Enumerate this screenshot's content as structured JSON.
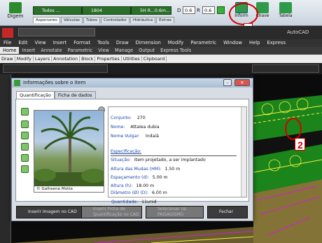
{
  "ribbon": {
    "digem_label": "Digem",
    "combo1_value": "Todos ...",
    "combo2_value": "1804",
    "combo3_value": "5H R...0.6m...",
    "d_label": "D",
    "d_value": "0.6",
    "r_label": "R",
    "r_value": "0.6",
    "tabs": [
      "Aspersores",
      "Válvulas",
      "Tubos",
      "Controlador",
      "Hidráulica",
      "Extras"
    ],
    "info_label": "Inform",
    "chave_label": "Chave",
    "tabela_label": "Tabela"
  },
  "acad": {
    "title": "AutoCAD",
    "menu": [
      "File",
      "Edit",
      "View",
      "Insert",
      "Format",
      "Tools",
      "Draw",
      "Dimension",
      "Modify",
      "Parametric",
      "Window",
      "Help",
      "Express"
    ],
    "tabs": [
      "Home",
      "Insert",
      "Annotate",
      "Parametric",
      "View",
      "Manage",
      "Output",
      "Express Tools"
    ],
    "panels": [
      "Draw",
      "Modify",
      "Layers",
      "Annotation",
      "Block",
      "Properties",
      "Utilities",
      "Clipboard"
    ]
  },
  "dialog": {
    "title": "Informações sobre o item",
    "tabs": [
      "Quantificação",
      "Ficha de dados"
    ],
    "photo_caption": "© Galheene Motta",
    "fields": [
      {
        "label": "Conjunto:",
        "value": "270"
      },
      {
        "label": "Nome:",
        "value": "Attalea dubia"
      },
      {
        "label": "Nome Vulgar:",
        "value": "Indaiá"
      }
    ],
    "spec_header": "Especificação:",
    "specs": [
      {
        "label": "Situação:",
        "value": "Item projetado, a ser implantado"
      },
      {
        "label": "Altura das Mudas (HM):",
        "value": "1.50 m"
      },
      {
        "label": "Espaçamento (d):",
        "value": "5.00 m"
      },
      {
        "label": "Altura (h):",
        "value": "18.00 m"
      },
      {
        "label": "Diâmetro (Ø) (D):",
        "value": "6.00 m"
      },
      {
        "label": "Quantidade:",
        "value": "11unid"
      }
    ],
    "footer": {
      "insert_image": "Inserir Imagem no CAD",
      "insert_qty": "Inserir Ficha de Quantificação no CAD",
      "select": "Selecionar na PAISAGISMO",
      "close": "Fechar"
    }
  },
  "markers": {
    "first": "1",
    "second": "2"
  },
  "colors": {
    "accent_green": "#2c6f2b",
    "marker_red": "#d40000",
    "drawing_green": "#1f9a1f",
    "drawing_yellow": "#f2f23a",
    "drawing_magenta": "#d31fd3"
  }
}
